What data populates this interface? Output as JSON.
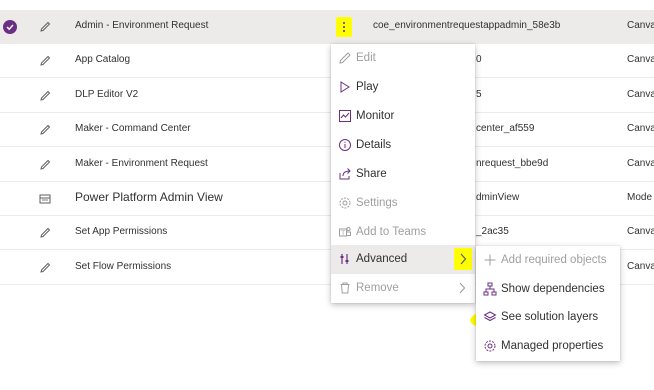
{
  "rows": [
    {
      "name": "Admin - Environment Request",
      "sysname": "coe_environmentrequestappadmin_58e3b",
      "kind": "Canva",
      "icon": "pencil-icon",
      "selected": true
    },
    {
      "name": "App Catalog",
      "sysname": "0",
      "kind": "Canva",
      "icon": "pencil-icon"
    },
    {
      "name": "DLP Editor V2",
      "sysname": "5",
      "kind": "Canva",
      "icon": "pencil-icon"
    },
    {
      "name": "Maker - Command Center",
      "sysname": "center_af559",
      "kind": "Canva",
      "icon": "pencil-icon"
    },
    {
      "name": "Maker - Environment Request",
      "sysname": "nrequest_bbe9d",
      "kind": "Canva",
      "icon": "pencil-icon"
    },
    {
      "name": "Power Platform Admin View",
      "sysname": "dminView",
      "kind": "Mode",
      "icon": "model-app-icon"
    },
    {
      "name": "Set App Permissions",
      "sysname": "_2ac35",
      "kind": "Canva",
      "icon": "pencil-icon"
    },
    {
      "name": "Set Flow Permissions",
      "sysname": "",
      "kind": "Canva",
      "icon": "pencil-icon"
    }
  ],
  "context_menu": {
    "items": [
      {
        "label": "Edit",
        "icon": "pencil-icon",
        "disabled": true
      },
      {
        "label": "Play",
        "icon": "play-icon"
      },
      {
        "label": "Monitor",
        "icon": "monitor-icon"
      },
      {
        "label": "Details",
        "icon": "info-icon"
      },
      {
        "label": "Share",
        "icon": "share-icon"
      },
      {
        "label": "Settings",
        "icon": "gear-icon",
        "disabled": true
      },
      {
        "label": "Add to Teams",
        "icon": "teams-icon",
        "disabled": true
      },
      {
        "label": "Advanced",
        "icon": "advanced-icon",
        "submenu": true
      },
      {
        "label": "Remove",
        "icon": "trash-icon",
        "disabled": true,
        "submenu": true
      }
    ]
  },
  "advanced_submenu": {
    "items": [
      {
        "label": "Add required objects",
        "icon": "plus-icon",
        "disabled": true
      },
      {
        "label": "Show dependencies",
        "icon": "dependencies-icon"
      },
      {
        "label": "See solution layers",
        "icon": "layers-icon",
        "highlighted": true
      },
      {
        "label": "Managed properties",
        "icon": "gear-icon"
      }
    ]
  },
  "colors": {
    "accent": "#6b2f84",
    "highlight": "#ffff00",
    "selected_row": "#edebe9",
    "disabled_text": "#a19f9d"
  }
}
